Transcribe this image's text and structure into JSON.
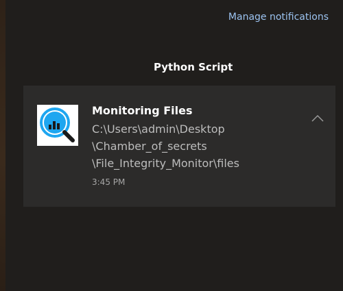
{
  "header": {
    "manage_label": "Manage notifications"
  },
  "group": {
    "app_name": "Python Script"
  },
  "notification": {
    "icon": "magnifier-chart-icon",
    "title": "Monitoring Files",
    "body_lines": [
      "C:\\Users\\admin\\Desktop",
      "\\Chamber_of_secrets",
      "\\File_Integrity_Monitor\\files"
    ],
    "time": "3:45 PM"
  },
  "colors": {
    "link": "#9cc3f0",
    "icon_blue": "#1ea6f0",
    "panel": "#201e1c",
    "toast": "#2c2b2a"
  }
}
